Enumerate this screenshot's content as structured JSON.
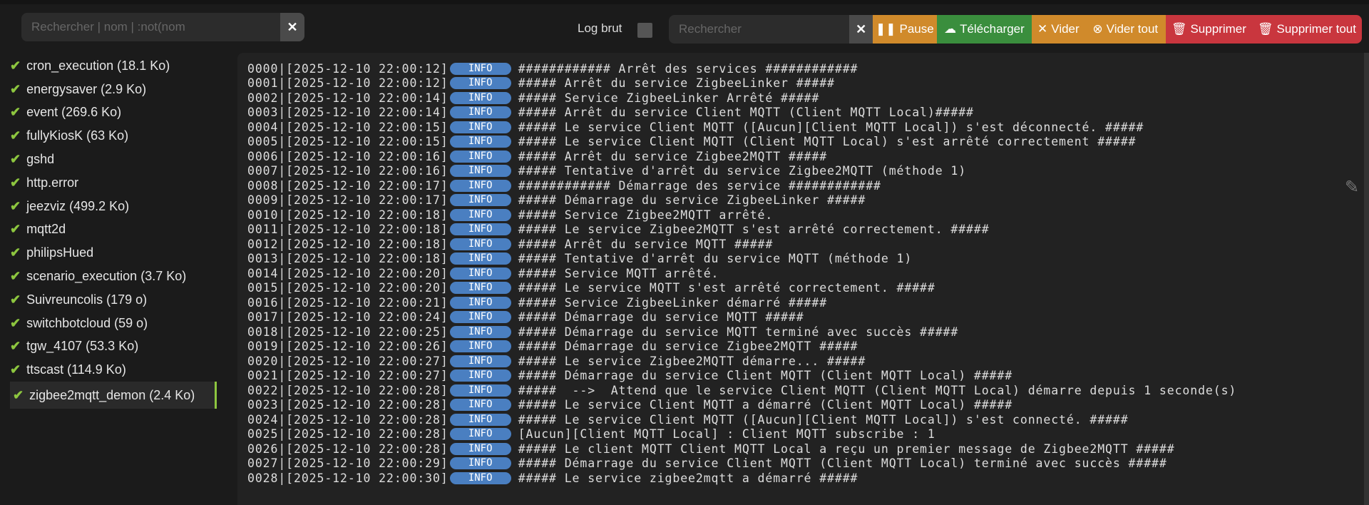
{
  "search": {
    "placeholder": "Rechercher | nom | :not(nom",
    "clear": "✕"
  },
  "log_brut": {
    "label": "Log brut",
    "checked": false
  },
  "toolbar": {
    "search_placeholder": "Rechercher",
    "clear": "✕",
    "pause": "Pause",
    "download": "Télécharger",
    "clear_log": "Vider",
    "clear_all": "Vider tout",
    "delete": "Supprimer",
    "delete_all": "Supprimer tout",
    "colors": {
      "orange": "#d08a2b",
      "green": "#3a8e3d",
      "red": "#c9363e"
    }
  },
  "sidebar": {
    "items": [
      {
        "label": "cron_execution (18.1 Ko)"
      },
      {
        "label": "energysaver (2.9 Ko)"
      },
      {
        "label": "event (269.6 Ko)"
      },
      {
        "label": "fullyKiosK (63 Ko)"
      },
      {
        "label": "gshd"
      },
      {
        "label": "http.error"
      },
      {
        "label": "jeezviz (499.2 Ko)"
      },
      {
        "label": "mqtt2d"
      },
      {
        "label": "philipsHued"
      },
      {
        "label": "scenario_execution (3.7 Ko)"
      },
      {
        "label": "Suivreuncolis (179 o)"
      },
      {
        "label": "switchbotcloud (59 o)"
      },
      {
        "label": "tgw_4107 (53.3 Ko)"
      },
      {
        "label": "ttscast (114.9 Ko)"
      },
      {
        "label": "zigbee2mqtt_demon (2.4 Ko)",
        "selected": true
      }
    ]
  },
  "log": {
    "level": "INFO",
    "lines": [
      [
        "0000|[2025-12-10 22:00:12]",
        "############ Arrêt des services ############"
      ],
      [
        "0001|[2025-12-10 22:00:12]",
        "##### Arrêt du service ZigbeeLinker #####"
      ],
      [
        "0002|[2025-12-10 22:00:14]",
        "##### Service ZigbeeLinker Arrêté #####"
      ],
      [
        "0003|[2025-12-10 22:00:14]",
        "##### Arrêt du service Client MQTT (Client MQTT Local)#####"
      ],
      [
        "0004|[2025-12-10 22:00:15]",
        "##### Le service Client MQTT ([Aucun][Client MQTT Local]) s'est déconnecté. #####"
      ],
      [
        "0005|[2025-12-10 22:00:15]",
        "##### Le service Client MQTT (Client MQTT Local) s'est arrêté correctement #####"
      ],
      [
        "0006|[2025-12-10 22:00:16]",
        "##### Arrêt du service Zigbee2MQTT #####"
      ],
      [
        "0007|[2025-12-10 22:00:16]",
        "##### Tentative d'arrêt du service Zigbee2MQTT (méthode 1)"
      ],
      [
        "0008|[2025-12-10 22:00:17]",
        "############ Démarrage des service ############"
      ],
      [
        "0009|[2025-12-10 22:00:17]",
        "##### Démarrage du service ZigbeeLinker #####"
      ],
      [
        "0010|[2025-12-10 22:00:18]",
        "##### Service Zigbee2MQTT arrêté."
      ],
      [
        "0011|[2025-12-10 22:00:18]",
        "##### Le service Zigbee2MQTT s'est arrêté correctement. #####"
      ],
      [
        "0012|[2025-12-10 22:00:18]",
        "##### Arrêt du service MQTT #####"
      ],
      [
        "0013|[2025-12-10 22:00:18]",
        "##### Tentative d'arrêt du service MQTT (méthode 1)"
      ],
      [
        "0014|[2025-12-10 22:00:20]",
        "##### Service MQTT arrêté."
      ],
      [
        "0015|[2025-12-10 22:00:20]",
        "##### Le service MQTT s'est arrêté correctement. #####"
      ],
      [
        "0016|[2025-12-10 22:00:21]",
        "##### Service ZigbeeLinker démarré #####"
      ],
      [
        "0017|[2025-12-10 22:00:24]",
        "##### Démarrage du service MQTT #####"
      ],
      [
        "0018|[2025-12-10 22:00:25]",
        "##### Démarrage du service MQTT terminé avec succès #####"
      ],
      [
        "0019|[2025-12-10 22:00:26]",
        "##### Démarrage du service Zigbee2MQTT #####"
      ],
      [
        "0020|[2025-12-10 22:00:27]",
        "##### Le service Zigbee2MQTT démarre... #####"
      ],
      [
        "0021|[2025-12-10 22:00:27]",
        "##### Démarrage du service Client MQTT (Client MQTT Local) #####"
      ],
      [
        "0022|[2025-12-10 22:00:28]",
        "#####  -->  Attend que le service Client MQTT (Client MQTT Local) démarre depuis 1 seconde(s)"
      ],
      [
        "0023|[2025-12-10 22:00:28]",
        "##### Le service Client MQTT a démarré (Client MQTT Local) #####"
      ],
      [
        "0024|[2025-12-10 22:00:28]",
        "##### Le service Client MQTT ([Aucun][Client MQTT Local]) s'est connecté. #####"
      ],
      [
        "0025|[2025-12-10 22:00:28]",
        "[Aucun][Client MQTT Local] : Client MQTT subscribe : 1"
      ],
      [
        "0026|[2025-12-10 22:00:28]",
        "##### Le client MQTT Client MQTT Local a reçu un premier message de Zigbee2MQTT #####"
      ],
      [
        "0027|[2025-12-10 22:00:29]",
        "##### Démarrage du service Client MQTT (Client MQTT Local) terminé avec succès #####"
      ],
      [
        "0028|[2025-12-10 22:00:30]",
        "##### Le service zigbee2mqtt a démarré #####"
      ]
    ]
  }
}
